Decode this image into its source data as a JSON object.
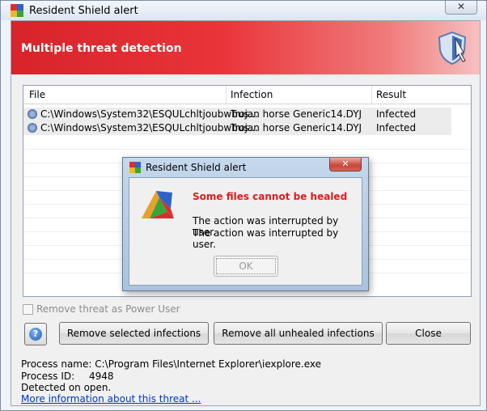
{
  "window": {
    "title": "Resident Shield alert",
    "close_glyph": "✕",
    "banner_title": "Multiple threat detection"
  },
  "table": {
    "columns": [
      "File",
      "Infection",
      "Result"
    ],
    "rows": [
      {
        "file": "C:\\Windows\\System32\\ESQULchltjoubwbus...",
        "infection": "Trojan horse Generic14.DYJ",
        "result": "Infected"
      },
      {
        "file": "C:\\Windows\\System32\\ESQULchltjoubwbus...",
        "infection": "Trojan horse Generic14.DYJ",
        "result": "Infected"
      }
    ]
  },
  "options": {
    "power_user_label": "Remove threat as Power User",
    "power_user_checked": false
  },
  "buttons": {
    "help": "?",
    "remove_selected": "Remove selected infections",
    "remove_all": "Remove all unhealed infections",
    "close": "Close"
  },
  "info": {
    "process_name": "Process name: C:\\Program Files\\Internet Explorer\\iexplore.exe",
    "process_id_label": "Process ID:",
    "process_id_value": "4948",
    "detected": "Detected on open.",
    "more_info_link": "More information about this threat ..."
  },
  "dialog": {
    "title": "Resident Shield alert",
    "close_glyph": "✕",
    "heading": "Some files cannot be healed",
    "messages": [
      "The action was interrupted by user.",
      "The action was interrupted by user."
    ],
    "ok_label": "OK"
  },
  "colors": {
    "banner_red": "#d8232a",
    "dialog_heading_red": "#e01b1b",
    "link_blue": "#0033cc"
  }
}
